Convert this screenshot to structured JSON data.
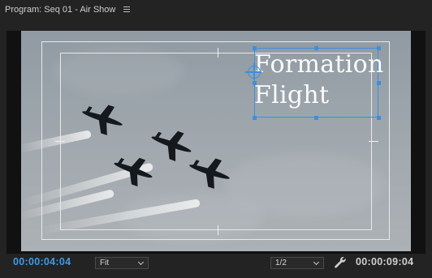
{
  "panel": {
    "title": "Program: Seq 01 - Air Show",
    "menu_icon": "hamburger-icon"
  },
  "title_overlay": {
    "line1": "Formation",
    "line2": "Flight"
  },
  "controls": {
    "current_timecode": "00:00:04:04",
    "zoom_value": "Fit",
    "resolution_value": "1/2",
    "settings_icon": "wrench-icon",
    "duration_timecode": "00:00:09:04"
  },
  "colors": {
    "accent_blue": "#3d9bea",
    "selection_blue": "#3c8fe0",
    "panel_bg": "#232323"
  }
}
